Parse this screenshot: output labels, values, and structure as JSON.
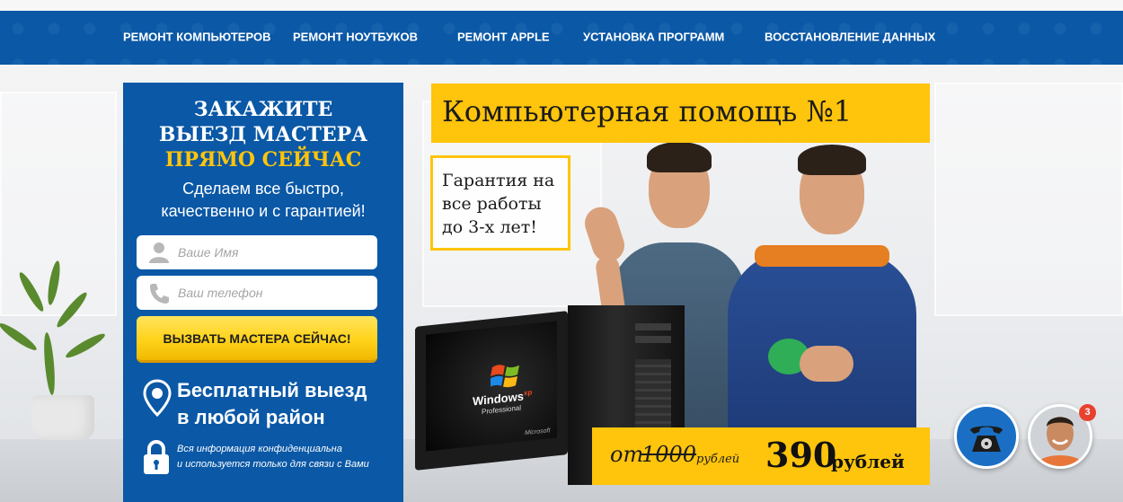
{
  "nav": {
    "items": [
      {
        "label": "РЕМОНТ КОМПЬЮТЕРОВ"
      },
      {
        "label": "РЕМОНТ НОУТБУКОВ"
      },
      {
        "label": "РЕМОНТ APPLE"
      },
      {
        "label": "УСТАНОВКА ПРОГРАММ"
      },
      {
        "label": "ВОССТАНОВЛЕНИЕ ДАННЫХ"
      }
    ]
  },
  "form": {
    "title_line1": "ЗАКАЖИТЕ",
    "title_line2": "ВЫЕЗД МАСТЕРА",
    "title_highlight": "ПРЯМО СЕЙЧАС",
    "subtitle_line1": "Сделаем все быстро,",
    "subtitle_line2": "качественно и с гарантией!",
    "name_placeholder": "Ваше Имя",
    "phone_placeholder": "Ваш телефон",
    "submit_label": "ВЫЗВАТЬ МАСТЕРА СЕЙЧАС!",
    "feature_line1": "Бесплатный выезд",
    "feature_line2": "в любой район",
    "privacy_line1": "Вся информация конфиденциальна",
    "privacy_line2": "и используется только для связи с Вами"
  },
  "hero": {
    "title": "Компьютерная помощь №1",
    "guarantee": "Гарантия на\nвсе работы\nдо 3-х лет!",
    "monitor_brand": "Windows",
    "monitor_edition": "Professional",
    "monitor_version": "xp",
    "monitor_vendor": "Microsoft",
    "price_prefix": "от",
    "price_old": "1000",
    "price_old_unit": "рублей",
    "price_new": "390",
    "price_new_unit": "рублей"
  },
  "widgets": {
    "chat_badge_count": "3"
  },
  "colors": {
    "brand_blue": "#0a58a6",
    "accent_yellow": "#ffc40c",
    "badge_red": "#e8412f"
  },
  "icons": [
    "user-icon",
    "phone-icon",
    "location-pin-icon",
    "lock-icon",
    "telephone-icon",
    "avatar"
  ]
}
